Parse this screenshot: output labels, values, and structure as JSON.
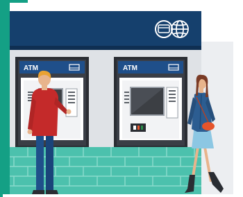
{
  "scene": {
    "atm_left": {
      "label": "ATM"
    },
    "atm_right": {
      "label": "ATM"
    }
  },
  "colors": {
    "frame_teal": "#14a085",
    "sign_navy": "#15406d",
    "wall_grey": "#dfe2e6",
    "tile_teal": "#4cc1ad",
    "atm_body_blue": "#1f4f8a",
    "man_shirt_red": "#c42a2a",
    "woman_jacket_blue": "#2c5d91",
    "woman_skirt": "#8cc7e3",
    "bag_orange": "#e5542b"
  },
  "icons": [
    "card-icon",
    "globe-icon",
    "card-slot-icon"
  ]
}
